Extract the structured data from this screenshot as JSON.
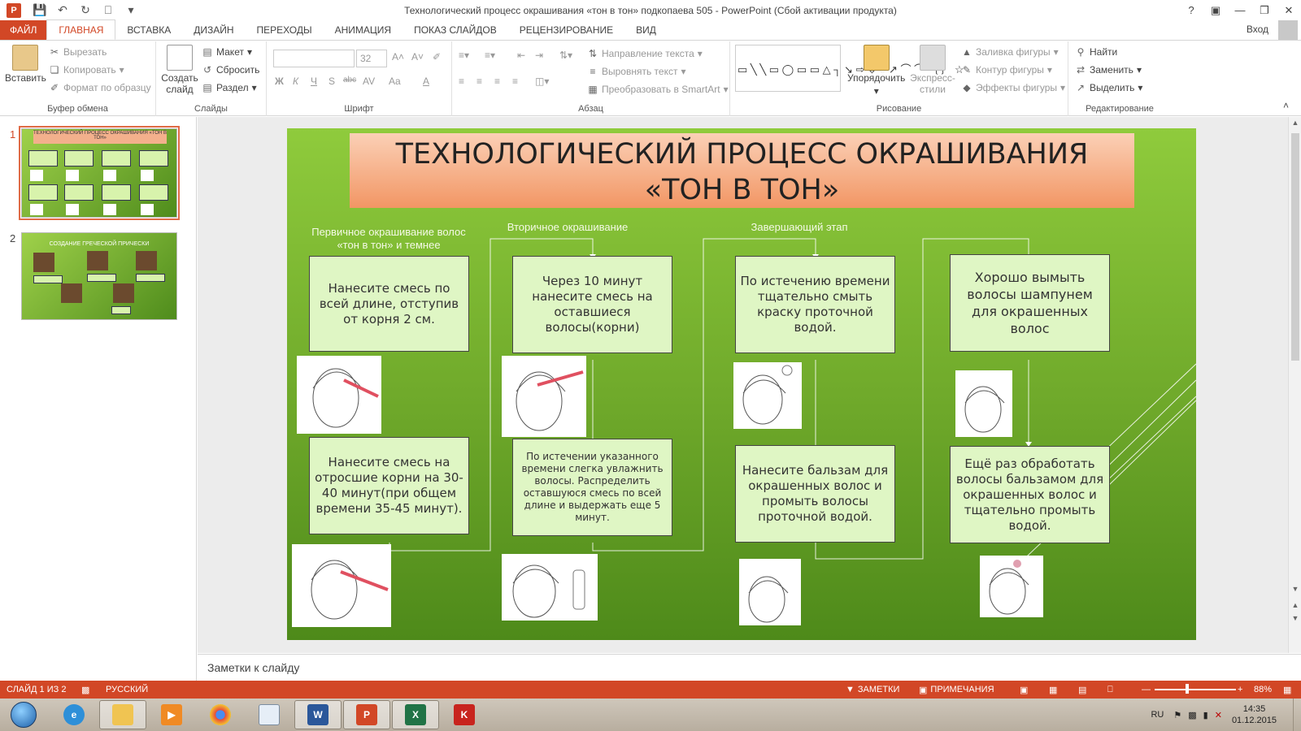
{
  "window": {
    "title": "Технологический процесс окрашивания «тон в тон» подкопаева 505 - PowerPoint (Сбой активации продукта)",
    "app_icon": "P",
    "help": "?",
    "login": "Вход"
  },
  "tabs": [
    "ФАЙЛ",
    "ГЛАВНАЯ",
    "ВСТАВКА",
    "ДИЗАЙН",
    "ПЕРЕХОДЫ",
    "АНИМАЦИЯ",
    "ПОКАЗ СЛАЙДОВ",
    "РЕЦЕНЗИРОВАНИЕ",
    "ВИД"
  ],
  "ribbon": {
    "clipboard": {
      "paste": "Вставить",
      "cut": "Вырезать",
      "copy": "Копировать",
      "format_painter": "Формат по образцу",
      "label": "Буфер обмена"
    },
    "slides": {
      "new_slide": "Создать слайд",
      "layout": "Макет",
      "reset": "Сбросить",
      "section": "Раздел",
      "label": "Слайды"
    },
    "font": {
      "size": "32",
      "bold": "Ж",
      "italic": "К",
      "underline": "Ч",
      "shadow": "S",
      "strike": "abc",
      "spacing": "AV",
      "case": "Aa",
      "color": "A",
      "label": "Шрифт"
    },
    "paragraph": {
      "text_direction": "Направление текста",
      "align_text": "Выровнять текст",
      "smartart": "Преобразовать в SmartArt",
      "label": "Абзац"
    },
    "drawing": {
      "arrange": "Упорядочить",
      "quick_styles": "Экспресс-стили",
      "fill": "Заливка фигуры",
      "outline": "Контур фигуры",
      "effects": "Эффекты фигуры",
      "label": "Рисование"
    },
    "editing": {
      "find": "Найти",
      "replace": "Заменить",
      "select": "Выделить",
      "label": "Редактирование"
    }
  },
  "thumbnails": [
    {
      "num": "1",
      "title": "ТЕХНОЛОГИЧЕСКИЙ ПРОЦЕСС ОКРАШИВАНИЯ «ТОН В ТОН»"
    },
    {
      "num": "2",
      "title": "СОЗДАНИЕ ГРЕЧЕСКОЙ ПРИЧЕСКИ"
    }
  ],
  "slide": {
    "title_line1": "ТЕХНОЛОГИЧЕСКИЙ ПРОЦЕСС ОКРАШИВАНИЯ",
    "title_line2": "«ТОН В ТОН»",
    "stages": [
      "Первичное окрашивание волос «тон в тон» и темнее",
      "Вторичное окрашивание",
      "Завершающий этап"
    ],
    "steps": [
      "Нанесите смесь по всей длине, отступив от корня 2 см.",
      "Нанесите смесь на отросшие корни на 30-40 минут(при общем времени 35-45 минут).",
      "Через 10 минут нанесите смесь на оставшиеся волосы(корни)",
      "По истечении указанного времени слегка увлажнить волосы. Распределить оставшуюся смесь по всей длине и выдержать еще 5 минут.",
      "По истечению времени тщательно смыть краску проточной водой.",
      "Нанесите бальзам для окрашенных волос и промыть волосы проточной водой.",
      "Хорошо вымыть волосы шампунем для окрашенных волос",
      "Ещё раз обработать волосы бальзамом для окрашенных волос и тщательно промыть водой."
    ]
  },
  "notes_placeholder": "Заметки к слайду",
  "status": {
    "slide": "СЛАЙД 1 ИЗ 2",
    "language": "РУССКИЙ",
    "notes": "ЗАМЕТКИ",
    "comments": "ПРИМЕЧАНИЯ",
    "zoom": "88%"
  },
  "taskbar": {
    "lang": "RU",
    "time": "14:35",
    "date": "01.12.2015"
  },
  "colors": {
    "accent": "#d24726",
    "slide_green": "#6ea82a",
    "box_fill": "#dff6c4",
    "title_fill": "#f29664"
  }
}
